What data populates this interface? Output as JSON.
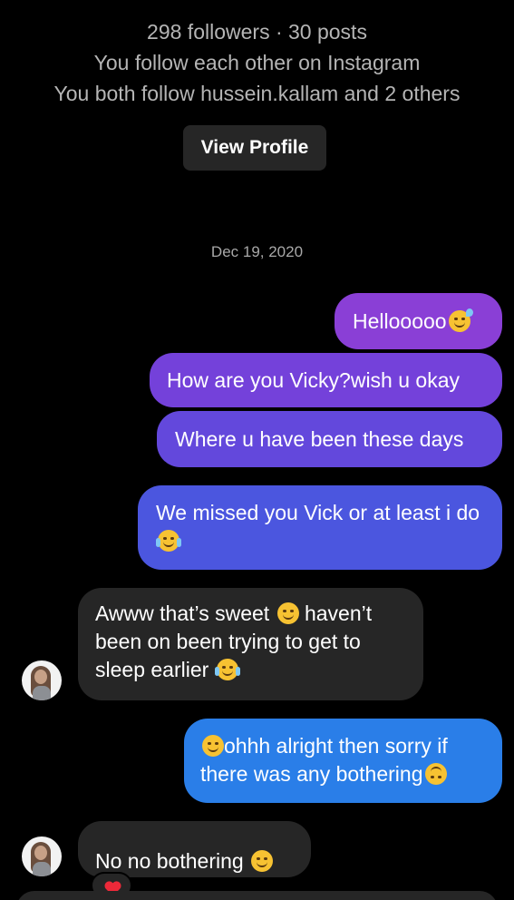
{
  "profile": {
    "stats": "298 followers · 30 posts",
    "mutual_follow": "You follow each other on Instagram",
    "shared_follows": "You both follow hussein.kallam and 2 others",
    "view_profile_label": "View Profile"
  },
  "thread": {
    "date_separator": "Dec 19, 2020",
    "messages": [
      {
        "direction": "sent",
        "text": "Hellooooo",
        "emoji": "sweat-smile-icon"
      },
      {
        "direction": "sent",
        "text": "How are you Vicky?wish u okay"
      },
      {
        "direction": "sent",
        "text": "Where u have been these days"
      },
      {
        "direction": "sent",
        "text": "We missed you Vick or at least i do",
        "emoji": "tears-of-joy-icon"
      },
      {
        "direction": "received",
        "text_before": "Awww that’s sweet",
        "emoji_1": "smiling-face-icon",
        "text_after": "haven’t been on been trying to get to sleep earlier",
        "emoji_2": "tears-of-joy-icon"
      },
      {
        "direction": "sent",
        "emoji_lead": "smiling-face-icon",
        "text": "ohhh alright then sorry if there was any bothering",
        "emoji_trail": "upside-down-face-icon"
      },
      {
        "direction": "received",
        "text": "No no bothering",
        "emoji": "smiling-face-icon",
        "reaction": "heart-icon"
      }
    ]
  },
  "colors": {
    "background": "#000000",
    "received_bubble": "#262626",
    "sent_gradient": [
      "#8a3fd6",
      "#7441da",
      "#6348dc",
      "#4b56df",
      "#2a7ee8"
    ],
    "meta_text": "#b5b5b5"
  }
}
